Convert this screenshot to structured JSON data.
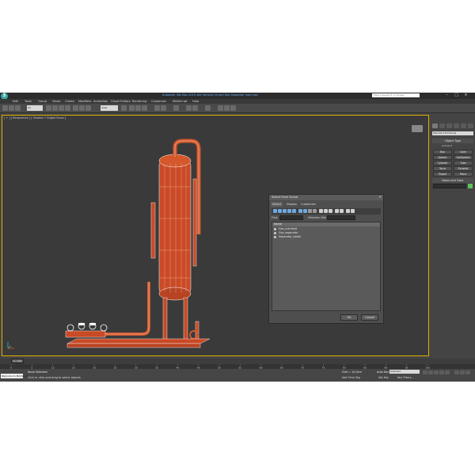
{
  "window": {
    "title": "Autodesk 3ds Max 2015 x64    Vertical Oil and Gas Separator max.max",
    "search_placeholder": "Type a keyword or phrase",
    "minimize": "–",
    "maximize": "□",
    "close": "×"
  },
  "menu": [
    "Edit",
    "Tools",
    "Group",
    "Views",
    "Create",
    "Modifiers",
    "Animation",
    "Graph Editors",
    "Rendering",
    "Customize",
    "MAXScript",
    "Help"
  ],
  "toolbar": {
    "selection_filter": "All",
    "reference_coord": "View"
  },
  "viewport": {
    "label": "[ + ] [ Perspective ] [ Shaded + Edged Faces ]",
    "model_color": "#d4502a",
    "wire_color": "#ffffff"
  },
  "dialog": {
    "title": "Select From Scene",
    "close": "×",
    "tabs": [
      "Select",
      "Display",
      "Customize"
    ],
    "find_label": "Find:",
    "selection_set_label": "Selection Set:",
    "list_header": "Name",
    "items": [
      "Gas_manifold",
      "Gas_separator",
      "Separator_detail"
    ],
    "ok": "OK",
    "cancel": "Cancel"
  },
  "cmdpanel": {
    "category": "Standard Primitives",
    "object_type": "Object Type",
    "autogrid": "AutoGrid",
    "primitives": [
      "Box",
      "Cone",
      "Sphere",
      "GeoSphere",
      "Cylinder",
      "Tube",
      "Torus",
      "Pyramid",
      "Teapot",
      "Plane"
    ],
    "name_and_color": "Name and Color",
    "color": "#5cc25c"
  },
  "timeline": {
    "frame": "0 / 100",
    "ticks": [
      "0",
      "5",
      "10",
      "15",
      "20",
      "25",
      "30",
      "35",
      "40",
      "45",
      "50",
      "55",
      "60",
      "65",
      "70",
      "75",
      "80",
      "85",
      "90",
      "95",
      "100"
    ]
  },
  "status": {
    "welcome": "Welcome to MAXScript",
    "line1": "None Selected",
    "line2": "Click or click-and-drag to select objects",
    "grid": "Grid = 10,0cm",
    "add_time_tag": "Add Time Tag",
    "auto_key": "Auto Key",
    "selected": "Selected",
    "set_key": "Set Key",
    "key_filters": "Key Filters..."
  }
}
